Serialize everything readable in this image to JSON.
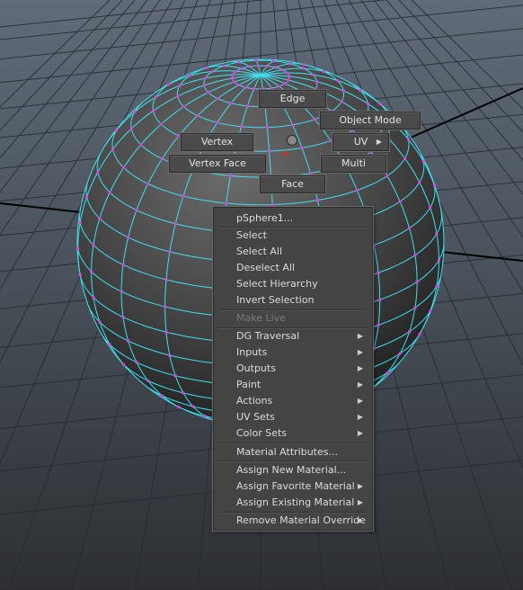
{
  "marking_menu": {
    "edge": "Edge",
    "object_mode": "Object Mode",
    "vertex": "Vertex",
    "uv": "UV",
    "vertex_face": "Vertex Face",
    "multi": "Multi",
    "face": "Face"
  },
  "context_menu": {
    "header": "pSphere1...",
    "items": [
      "Select",
      "Select All",
      "Deselect All",
      "Select Hierarchy",
      "Invert Selection",
      "Make Live",
      "DG Traversal",
      "Inputs",
      "Outputs",
      "Paint",
      "Actions",
      "UV Sets",
      "Color Sets",
      "Material Attributes...",
      "Assign New Material...",
      "Assign Favorite Material",
      "Assign Existing Material",
      "Remove Material Override"
    ]
  },
  "icons": {
    "submenu": "triangle-right-icon",
    "center": "circle-icon"
  },
  "colors": {
    "wireframe": "#3fe0f0",
    "vertex": "#e040e0",
    "selected_vertex": "#ff2020",
    "menu_bg": "#444444",
    "menu_text": "#dcdcdc",
    "disabled_text": "#7b7b7b"
  }
}
